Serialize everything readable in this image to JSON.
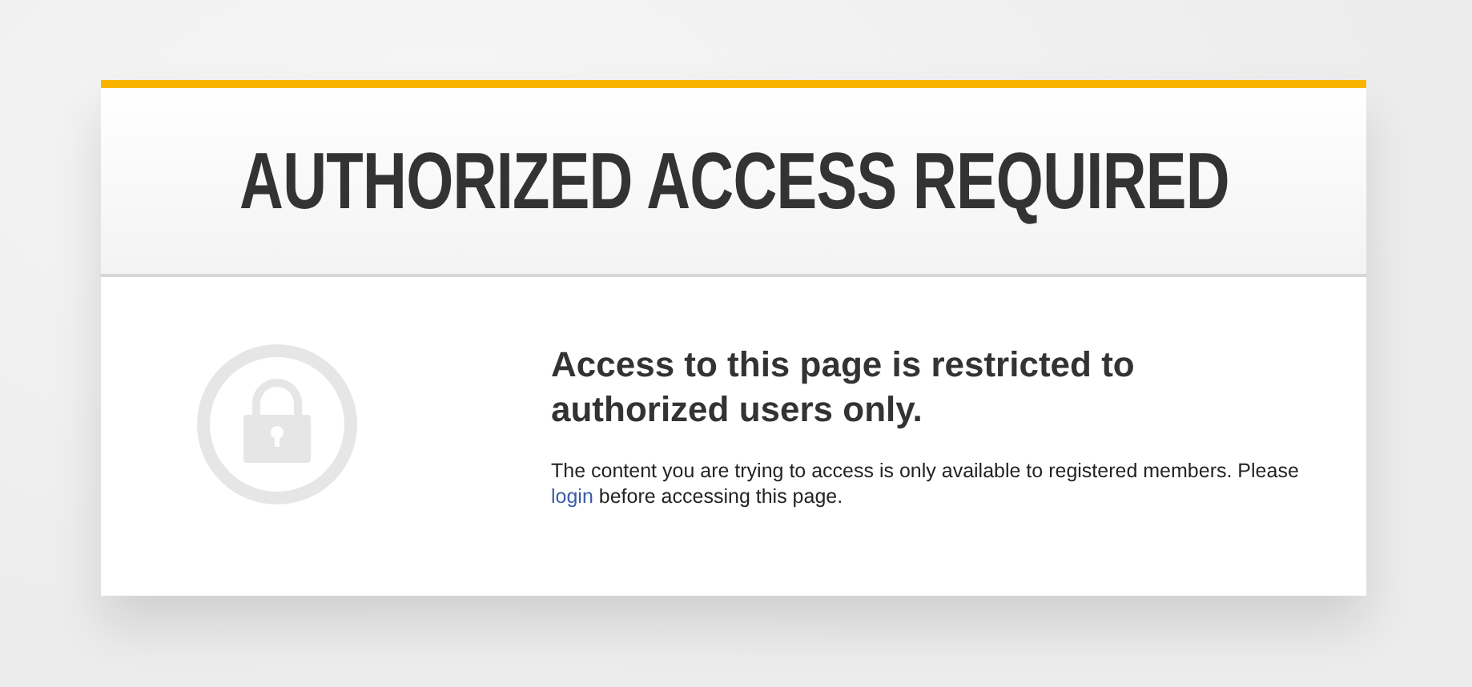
{
  "header": {
    "title": "AUTHORIZED ACCESS REQUIRED"
  },
  "content": {
    "heading": "Access to this page is restricted to authorized users only.",
    "message_before": "The content you are trying to access is only available to registered members. Please ",
    "link": "login",
    "message_after": " before accessing this page."
  }
}
